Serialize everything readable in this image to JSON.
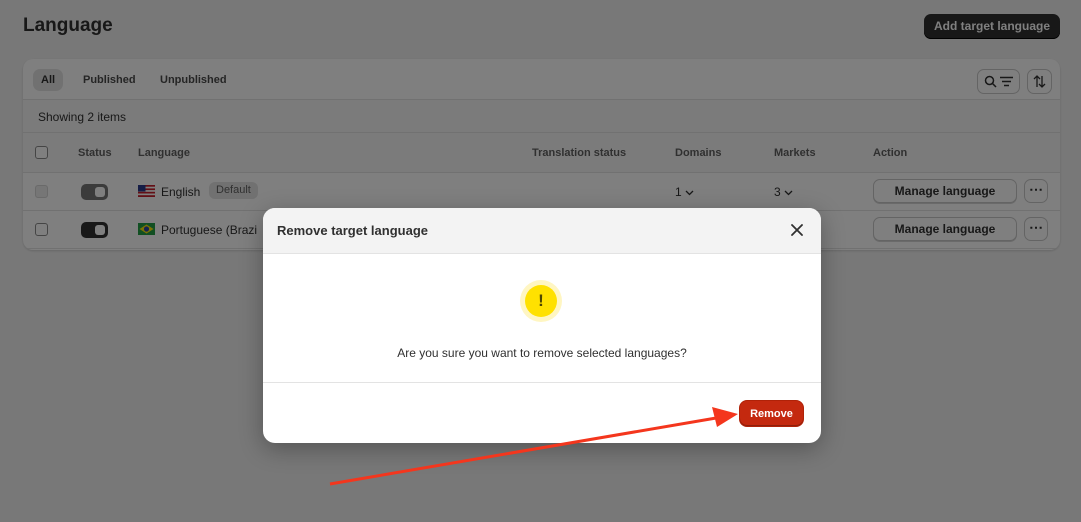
{
  "page": {
    "title": "Language",
    "add_button": "Add target language"
  },
  "tabs": [
    "All",
    "Published",
    "Unpublished"
  ],
  "showing": "Showing 2 items",
  "columns": [
    "Status",
    "Language",
    "Translation status",
    "Domains",
    "Markets",
    "Action"
  ],
  "rows": [
    {
      "language": "English",
      "badge": "Default",
      "domains": "1",
      "markets": "3",
      "action": "Manage language",
      "flag": "us-flag-icon"
    },
    {
      "language": "Portuguese (Brazil)",
      "visible_language": "Portuguese (Brazi",
      "action": "Manage language",
      "flag": "brazil-flag-icon"
    }
  ],
  "modal": {
    "title": "Remove target language",
    "message": "Are you sure you want to remove selected languages?",
    "warning_glyph": "!",
    "remove_label": "Remove"
  },
  "colors": {
    "destructive": "#c4290f",
    "warning": "#ffe100",
    "annotation_arrow": "#f4361d"
  }
}
